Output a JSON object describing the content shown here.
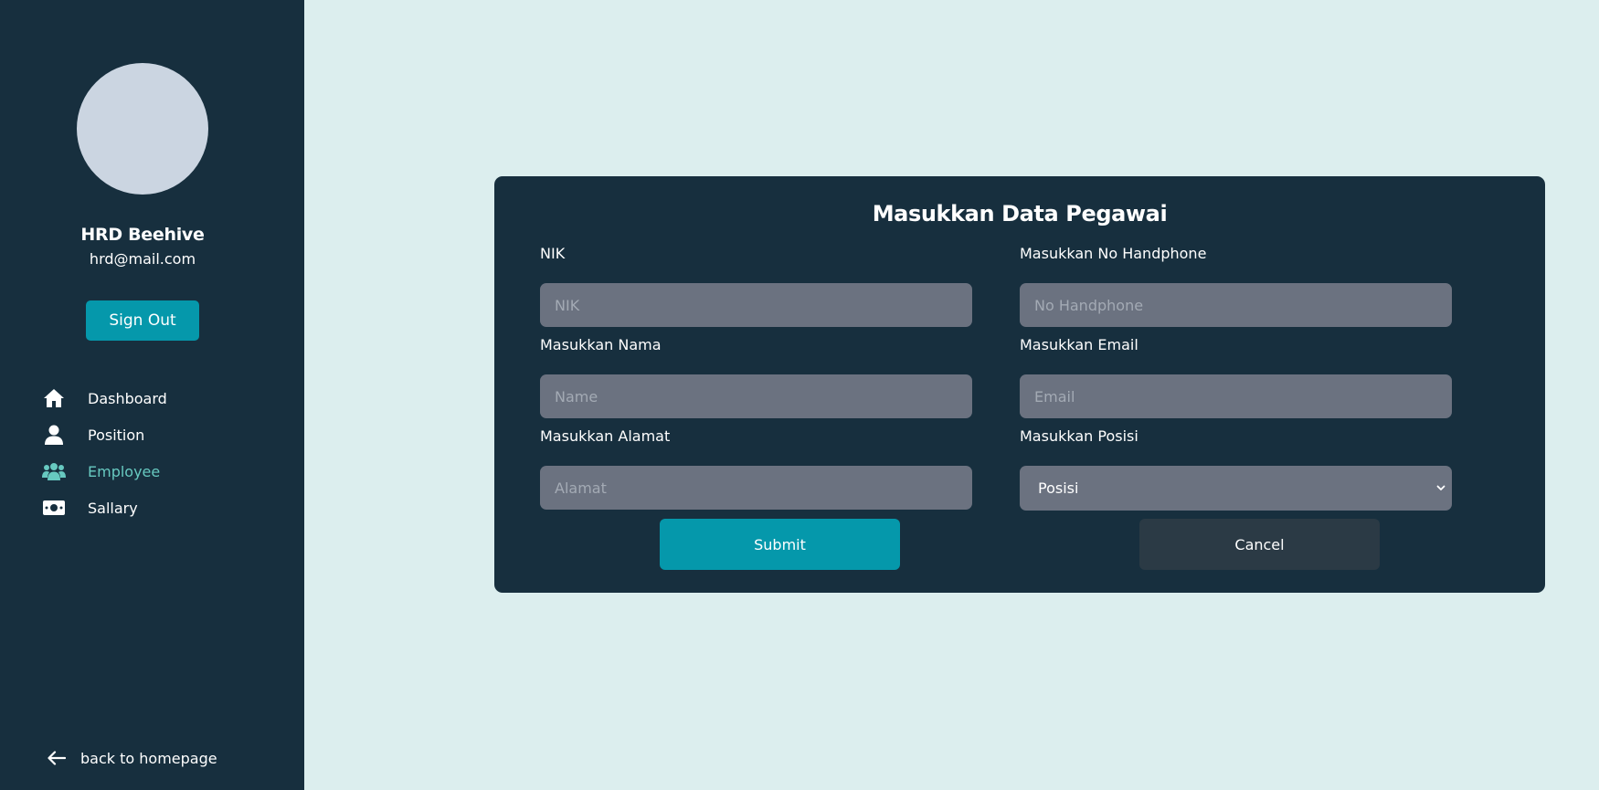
{
  "sidebar": {
    "user_name": "HRD Beehive",
    "user_email": "hrd@mail.com",
    "signout_label": "Sign Out",
    "nav": [
      {
        "label": "Dashboard",
        "icon": "home-icon"
      },
      {
        "label": "Position",
        "icon": "user-icon"
      },
      {
        "label": "Employee",
        "icon": "users-icon",
        "active": true
      },
      {
        "label": "Sallary",
        "icon": "money-icon"
      }
    ],
    "back_label": "back to homepage"
  },
  "form": {
    "title": "Masukkan Data Pegawai",
    "nik": {
      "label": "NIK",
      "placeholder": "NIK",
      "value": ""
    },
    "phone": {
      "label": "Masukkan No Handphone",
      "placeholder": "No Handphone",
      "value": ""
    },
    "name": {
      "label": "Masukkan Nama",
      "placeholder": "Name",
      "value": ""
    },
    "email": {
      "label": "Masukkan Email",
      "placeholder": "Email",
      "value": ""
    },
    "address": {
      "label": "Masukkan Alamat",
      "placeholder": "Alamat",
      "value": ""
    },
    "position": {
      "label": "Masukkan Posisi",
      "selected": "Posisi"
    },
    "submit_label": "Submit",
    "cancel_label": "Cancel"
  },
  "colors": {
    "sidebar_bg": "#172f3e",
    "page_bg": "#dceeee",
    "accent": "#0598ab",
    "active_nav": "#67c9c0",
    "input_bg": "#6b7280"
  }
}
